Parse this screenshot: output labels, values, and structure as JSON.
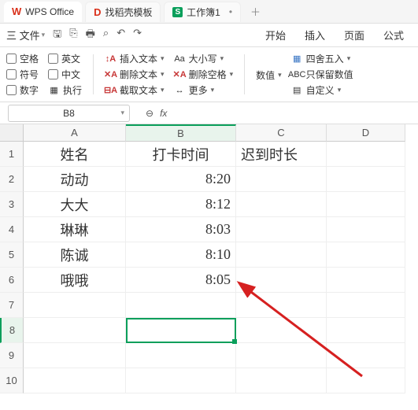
{
  "titlebar": {
    "app": "WPS Office",
    "tab2": "找稻壳模板",
    "tab3": "工作簿1"
  },
  "menubar": {
    "menu": "三 文件",
    "items": [
      "开始",
      "插入",
      "页面",
      "公式"
    ]
  },
  "ribbon": {
    "checks_col1": [
      "空格",
      "符号",
      "数字"
    ],
    "checks_col2": [
      "英文",
      "中文",
      "执行"
    ],
    "insert_text": "插入文本",
    "delete_text": "删除文本",
    "extract_text": "截取文本",
    "case": "大小写",
    "del_space": "删除空格",
    "more": "更多",
    "numeric": "数值",
    "round": "四舍五入",
    "keep_value": "只保留数值",
    "custom": "自定义"
  },
  "formula": {
    "namebox": "B8",
    "fx": "fx"
  },
  "cols": [
    "A",
    "B",
    "C",
    "D"
  ],
  "rows": [
    "1",
    "2",
    "3",
    "4",
    "5",
    "6",
    "7",
    "8",
    "9",
    "10"
  ],
  "data": {
    "headers": [
      "姓名",
      "打卡时间",
      "迟到时长"
    ],
    "body": [
      [
        "动动",
        "8:20"
      ],
      [
        "大大",
        "8:12"
      ],
      [
        "琳琳",
        "8:03"
      ],
      [
        "陈诚",
        "8:10"
      ],
      [
        "哦哦",
        "8:05"
      ]
    ]
  }
}
